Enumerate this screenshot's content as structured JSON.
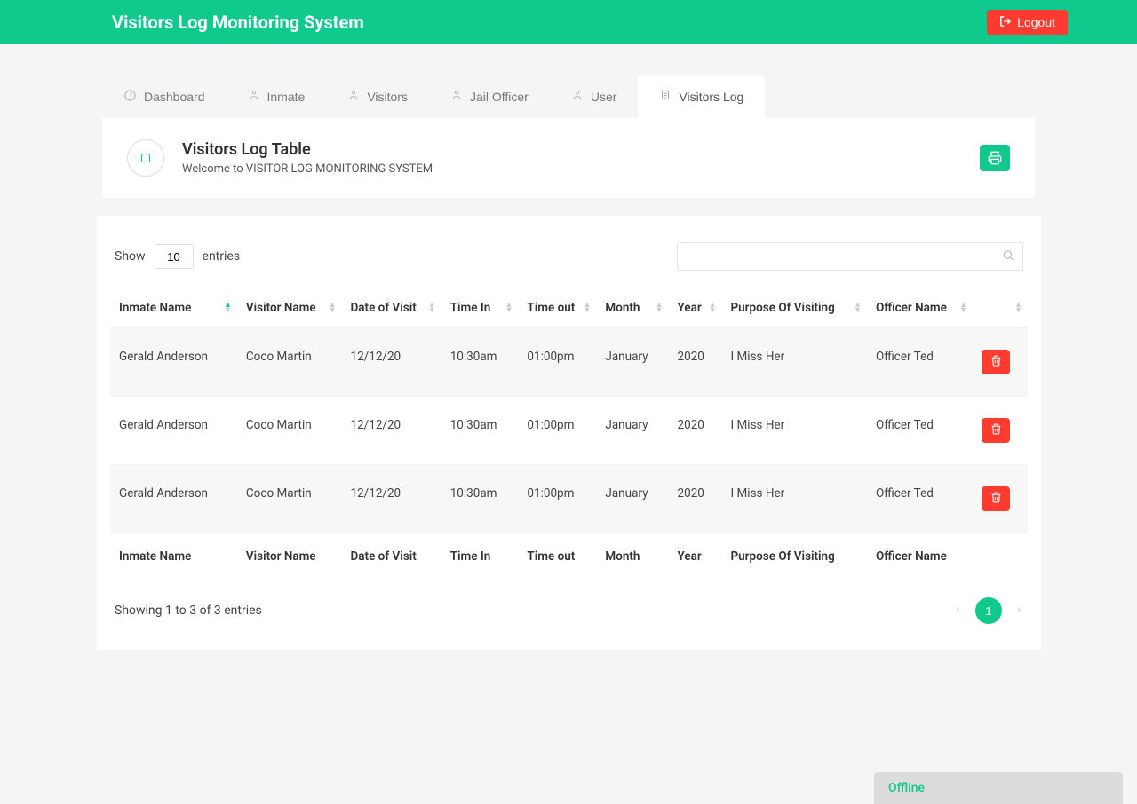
{
  "header": {
    "title": "Visitors Log Monitoring System",
    "logout_label": "Logout"
  },
  "tabs": [
    {
      "label": "Dashboard",
      "icon": "dashboard"
    },
    {
      "label": "Inmate",
      "icon": "person"
    },
    {
      "label": "Visitors",
      "icon": "person"
    },
    {
      "label": "Jail Officer",
      "icon": "person"
    },
    {
      "label": "User",
      "icon": "person"
    },
    {
      "label": "Visitors Log",
      "icon": "clipboard",
      "active": true
    }
  ],
  "panel": {
    "title": "Visitors Log Table",
    "subtitle": "Welcome to VISITOR LOG MONITORING SYSTEM"
  },
  "table_controls": {
    "show_label": "Show",
    "entries_value": "10",
    "entries_label": "entries"
  },
  "columns": [
    "Inmate Name",
    "Visitor Name",
    "Date of Visit",
    "Time In",
    "Time out",
    "Month",
    "Year",
    "Purpose Of Visiting",
    "Officer Name"
  ],
  "rows": [
    {
      "inmate": "Gerald Anderson",
      "visitor": "Coco Martin",
      "date": "12/12/20",
      "in": "10:30am",
      "out": "01:00pm",
      "month": "January",
      "year": "2020",
      "purpose": "I Miss Her",
      "officer": "Officer Ted"
    },
    {
      "inmate": "Gerald Anderson",
      "visitor": "Coco Martin",
      "date": "12/12/20",
      "in": "10:30am",
      "out": "01:00pm",
      "month": "January",
      "year": "2020",
      "purpose": "I Miss Her",
      "officer": "Officer Ted"
    },
    {
      "inmate": "Gerald Anderson",
      "visitor": "Coco Martin",
      "date": "12/12/20",
      "in": "10:30am",
      "out": "01:00pm",
      "month": "January",
      "year": "2020",
      "purpose": "I Miss Her",
      "officer": "Officer Ted"
    }
  ],
  "footer": {
    "showing": "Showing 1 to 3 of 3 entries",
    "page": "1"
  },
  "status": {
    "offline": "Offline"
  }
}
